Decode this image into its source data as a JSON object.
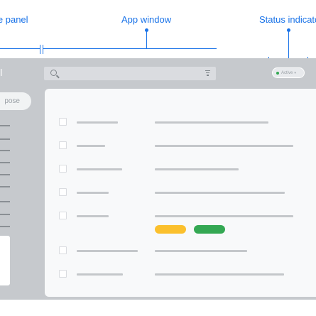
{
  "callouts": {
    "side_panel": "le panel",
    "app_window": "App window",
    "status_indicator": "Status indicato"
  },
  "app": {
    "name_fragment": "il",
    "compose_label": "pose",
    "status_label": "Active",
    "status_caret": "▾"
  },
  "colors": {
    "accent": "#1a73e8",
    "frame": "#c6c9cd",
    "tag_yellow": "#fbc02d",
    "tag_green": "#34a853"
  },
  "icons": [
    "search-icon",
    "filter-icon",
    "status-dot-icon",
    "checkbox-icon"
  ],
  "rows": [
    {
      "tags": []
    },
    {
      "tags": []
    },
    {
      "tags": []
    },
    {
      "tags": []
    },
    {
      "tags": [
        "yellow",
        "green"
      ]
    },
    {
      "tags": []
    },
    {
      "tags": []
    }
  ]
}
